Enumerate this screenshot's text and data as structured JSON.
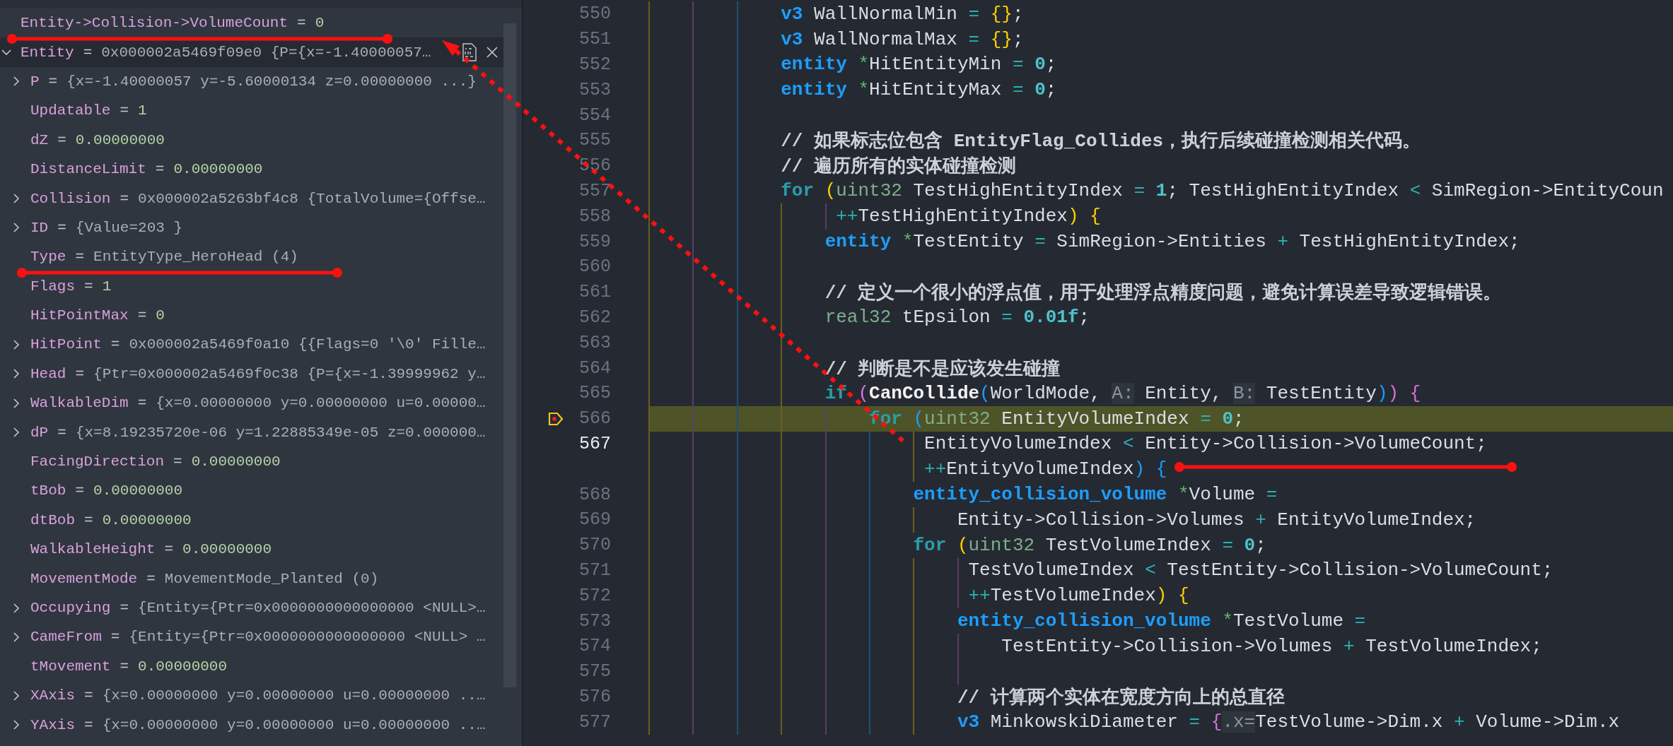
{
  "watch": {
    "items": [
      {
        "kind": "number",
        "selected": false,
        "name": "Entity->Collision->VolumeCount",
        "op": "=",
        "value": "0"
      },
      {
        "kind": "group",
        "expanded": true,
        "selected": true,
        "name": "Entity",
        "op": "=",
        "value": "0x000002a5469f09e0 {P={x=-1.40000057…",
        "children": [
          {
            "kind": "group",
            "expanded": false,
            "selected": false,
            "name": "P",
            "op": "=",
            "value": "{x=-1.40000057 y=-5.60000134 z=0.00000000 ...}"
          },
          {
            "kind": "number",
            "selected": false,
            "name": "Updatable",
            "op": "=",
            "value": "1"
          },
          {
            "kind": "number",
            "selected": false,
            "name": "dZ",
            "op": "=",
            "value": "0.00000000"
          },
          {
            "kind": "number",
            "selected": false,
            "name": "DistanceLimit",
            "op": "=",
            "value": "0.00000000"
          },
          {
            "kind": "group",
            "expanded": false,
            "selected": false,
            "name": "Collision",
            "op": "=",
            "value": "0x000002a5263bf4c8 {TotalVolume={Offse…"
          },
          {
            "kind": "group",
            "expanded": false,
            "selected": false,
            "name": "ID",
            "op": "=",
            "value": "{Value=203 }"
          },
          {
            "kind": "text",
            "selected": false,
            "name": "Type",
            "op": "=",
            "value": "EntityType_HeroHead (4)"
          },
          {
            "kind": "number",
            "selected": false,
            "name": "Flags",
            "op": "=",
            "value": "1"
          },
          {
            "kind": "number",
            "selected": false,
            "name": "HitPointMax",
            "op": "=",
            "value": "0"
          },
          {
            "kind": "group",
            "expanded": false,
            "selected": false,
            "name": "HitPoint",
            "op": "=",
            "value": "0x000002a5469f0a10 {{Flags=0 '\\0' Fille…"
          },
          {
            "kind": "group",
            "expanded": false,
            "selected": false,
            "name": "Head",
            "op": "=",
            "value": "{Ptr=0x000002a5469f0c38 {P={x=-1.39999962 y…"
          },
          {
            "kind": "group",
            "expanded": false,
            "selected": false,
            "name": "WalkableDim",
            "op": "=",
            "value": "{x=0.00000000 y=0.00000000 u=0.00000…"
          },
          {
            "kind": "group",
            "expanded": false,
            "selected": false,
            "name": "dP",
            "op": "=",
            "value": "{x=8.19235720e-06 y=1.22885349e-05 z=0.000000…"
          },
          {
            "kind": "number",
            "selected": false,
            "name": "FacingDirection",
            "op": "=",
            "value": "0.00000000"
          },
          {
            "kind": "number",
            "selected": false,
            "name": "tBob",
            "op": "=",
            "value": "0.00000000"
          },
          {
            "kind": "number",
            "selected": false,
            "name": "dtBob",
            "op": "=",
            "value": "0.00000000"
          },
          {
            "kind": "number",
            "selected": false,
            "name": "WalkableHeight",
            "op": "=",
            "value": "0.00000000"
          },
          {
            "kind": "text",
            "selected": false,
            "name": "MovementMode",
            "op": "=",
            "value": "MovementMode_Planted (0)"
          },
          {
            "kind": "group",
            "expanded": false,
            "selected": false,
            "name": "Occupying",
            "op": "=",
            "value": "{Entity={Ptr=0x0000000000000000 <NULL>…"
          },
          {
            "kind": "group",
            "expanded": false,
            "selected": false,
            "name": "CameFrom",
            "op": "=",
            "value": "{Entity={Ptr=0x0000000000000000 <NULL> …"
          },
          {
            "kind": "number",
            "selected": false,
            "name": "tMovement",
            "op": "=",
            "value": "0.00000000"
          },
          {
            "kind": "group",
            "expanded": false,
            "selected": false,
            "name": "XAxis",
            "op": "=",
            "value": "{x=0.00000000 y=0.00000000 u=0.00000000 ..…"
          },
          {
            "kind": "group",
            "expanded": false,
            "selected": false,
            "name": "YAxis",
            "op": "=",
            "value": "{x=0.00000000 y=0.00000000 u=0.00000000 ..…"
          }
        ]
      }
    ]
  },
  "editor": {
    "lines": [
      {
        "kind": "line",
        "number": "550",
        "tokens": [
          {
            "kind": "type",
            "text": "            v3"
          },
          {
            "kind": "plain",
            "text": " WallNormalMin "
          },
          {
            "kind": "op",
            "text": "="
          },
          {
            "kind": "b1",
            "text": " {}"
          },
          {
            "kind": "punct",
            "text": ";"
          }
        ]
      },
      {
        "kind": "line",
        "number": "551",
        "tokens": [
          {
            "kind": "type",
            "text": "            v3"
          },
          {
            "kind": "plain",
            "text": " WallNormalMax "
          },
          {
            "kind": "op",
            "text": "="
          },
          {
            "kind": "b1",
            "text": " {}"
          },
          {
            "kind": "punct",
            "text": ";"
          }
        ]
      },
      {
        "kind": "line",
        "number": "552",
        "tokens": [
          {
            "kind": "type",
            "text": "            entity"
          },
          {
            "kind": "ptr",
            "text": " *"
          },
          {
            "kind": "plain",
            "text": "HitEntityMin "
          },
          {
            "kind": "op",
            "text": "="
          },
          {
            "kind": "num",
            "text": " 0"
          },
          {
            "kind": "punct",
            "text": ";"
          }
        ]
      },
      {
        "kind": "line",
        "number": "553",
        "tokens": [
          {
            "kind": "type",
            "text": "            entity"
          },
          {
            "kind": "ptr",
            "text": " *"
          },
          {
            "kind": "plain",
            "text": "HitEntityMax "
          },
          {
            "kind": "op",
            "text": "="
          },
          {
            "kind": "num",
            "text": " 0"
          },
          {
            "kind": "punct",
            "text": ";"
          }
        ]
      },
      {
        "kind": "line",
        "number": "554"
      },
      {
        "kind": "line",
        "number": "555",
        "tokens": [
          {
            "kind": "comment",
            "text": "            // 如果标志位包含 EntityFlag_Collides，执行后续碰撞检测相关代码。"
          }
        ]
      },
      {
        "kind": "line",
        "number": "556",
        "tokens": [
          {
            "kind": "comment",
            "text": "            // 遍历所有的实体碰撞检测"
          }
        ]
      },
      {
        "kind": "line",
        "number": "557",
        "tokens": [
          {
            "kind": "kw",
            "text": "            for"
          },
          {
            "kind": "b1",
            "text": " ("
          },
          {
            "kind": "prim",
            "text": "uint32"
          },
          {
            "kind": "plain",
            "text": " TestHighEntityIndex "
          },
          {
            "kind": "op",
            "text": "="
          },
          {
            "kind": "num",
            "text": " 1"
          },
          {
            "kind": "punct",
            "text": ";"
          },
          {
            "kind": "plain",
            "text": " TestHighEntityIndex "
          },
          {
            "kind": "op",
            "text": "<"
          },
          {
            "kind": "plain",
            "text": " SimRegion->EntityCoun"
          }
        ]
      },
      {
        "kind": "line",
        "number": "558",
        "tokens": [
          {
            "kind": "op",
            "text": "                 ++"
          },
          {
            "kind": "plain",
            "text": "TestHighEntityIndex"
          },
          {
            "kind": "b1",
            "text": ")"
          },
          {
            "kind": "b1",
            "text": " {"
          }
        ]
      },
      {
        "kind": "line",
        "number": "559",
        "tokens": [
          {
            "kind": "type",
            "text": "                entity"
          },
          {
            "kind": "ptr",
            "text": " *"
          },
          {
            "kind": "plain",
            "text": "TestEntity "
          },
          {
            "kind": "op",
            "text": "="
          },
          {
            "kind": "plain",
            "text": " SimRegion->Entities "
          },
          {
            "kind": "op",
            "text": "+"
          },
          {
            "kind": "plain",
            "text": " TestHighEntityIndex;"
          }
        ]
      },
      {
        "kind": "line",
        "number": "560"
      },
      {
        "kind": "line",
        "number": "561",
        "tokens": [
          {
            "kind": "comment",
            "text": "                // 定义一个很小的浮点值，用于处理浮点精度问题，避免计算误差导致逻辑错误。"
          }
        ]
      },
      {
        "kind": "line",
        "number": "562",
        "tokens": [
          {
            "kind": "prim",
            "text": "                real32"
          },
          {
            "kind": "plain",
            "text": " tEpsilon "
          },
          {
            "kind": "op",
            "text": "="
          },
          {
            "kind": "num",
            "text": " 0.01f"
          },
          {
            "kind": "punct",
            "text": ";"
          }
        ]
      },
      {
        "kind": "line",
        "number": "563"
      },
      {
        "kind": "line",
        "number": "564",
        "tokens": [
          {
            "kind": "comment",
            "text": "                // 判断是不是应该发生碰撞"
          }
        ]
      },
      {
        "kind": "line",
        "number": "565",
        "tokens": [
          {
            "kind": "kw",
            "text": "                if"
          },
          {
            "kind": "b2",
            "text": " ("
          },
          {
            "kind": "func",
            "text": "CanCollide"
          },
          {
            "kind": "b3",
            "text": "("
          },
          {
            "kind": "plain",
            "text": "WorldMode, "
          },
          {
            "kind": "hint",
            "text": "A:"
          },
          {
            "kind": "plain",
            "text": " Entity, "
          },
          {
            "kind": "hint",
            "text": "B:"
          },
          {
            "kind": "plain",
            "text": " TestEntity"
          },
          {
            "kind": "b3",
            "text": ")"
          },
          {
            "kind": "b2",
            "text": ")"
          },
          {
            "kind": "b2",
            "text": " {"
          }
        ]
      },
      {
        "kind": "paused",
        "number": "566",
        "tokens": [
          {
            "kind": "kw",
            "text": "                    for"
          },
          {
            "kind": "b3",
            "text": " ("
          },
          {
            "kind": "prim",
            "text": "uint32"
          },
          {
            "kind": "plain",
            "text": " EntityVolumeIndex "
          },
          {
            "kind": "op",
            "text": "="
          },
          {
            "kind": "num",
            "text": " 0"
          },
          {
            "kind": "punct",
            "text": ";"
          }
        ]
      },
      {
        "kind": "cursor",
        "number": "567",
        "tokens": [
          {
            "kind": "plain",
            "text": "                         EntityVolumeIndex "
          },
          {
            "kind": "op",
            "text": "<"
          },
          {
            "kind": "plain",
            "text": " Entity->Collision->VolumeCount;"
          }
        ]
      },
      {
        "kind": "wrap",
        "tokens": [
          {
            "kind": "op",
            "text": "                         ++"
          },
          {
            "kind": "plain",
            "text": "EntityVolumeIndex"
          },
          {
            "kind": "b3",
            "text": ")"
          },
          {
            "kind": "b3",
            "text": " {"
          }
        ]
      },
      {
        "kind": "line",
        "number": "568",
        "tokens": [
          {
            "kind": "type",
            "text": "                        entity_collision_volume"
          },
          {
            "kind": "ptr",
            "text": " *"
          },
          {
            "kind": "plain",
            "text": "Volume "
          },
          {
            "kind": "op",
            "text": "="
          }
        ]
      },
      {
        "kind": "line",
        "number": "569",
        "tokens": [
          {
            "kind": "plain",
            "text": "                            Entity->Collision->Volumes "
          },
          {
            "kind": "op",
            "text": "+"
          },
          {
            "kind": "plain",
            "text": " EntityVolumeIndex;"
          }
        ]
      },
      {
        "kind": "line",
        "number": "570",
        "tokens": [
          {
            "kind": "kw",
            "text": "                        for"
          },
          {
            "kind": "b1",
            "text": " ("
          },
          {
            "kind": "prim",
            "text": "uint32"
          },
          {
            "kind": "plain",
            "text": " TestVolumeIndex "
          },
          {
            "kind": "op",
            "text": "="
          },
          {
            "kind": "num",
            "text": " 0"
          },
          {
            "kind": "punct",
            "text": ";"
          }
        ]
      },
      {
        "kind": "line",
        "number": "571",
        "tokens": [
          {
            "kind": "plain",
            "text": "                             TestVolumeIndex "
          },
          {
            "kind": "op",
            "text": "<"
          },
          {
            "kind": "plain",
            "text": " TestEntity->Collision->VolumeCount;"
          }
        ]
      },
      {
        "kind": "line",
        "number": "572",
        "tokens": [
          {
            "kind": "op",
            "text": "                             ++"
          },
          {
            "kind": "plain",
            "text": "TestVolumeIndex"
          },
          {
            "kind": "b1",
            "text": ")"
          },
          {
            "kind": "b1",
            "text": " {"
          }
        ]
      },
      {
        "kind": "line",
        "number": "573",
        "tokens": [
          {
            "kind": "type",
            "text": "                            entity_collision_volume"
          },
          {
            "kind": "ptr",
            "text": " *"
          },
          {
            "kind": "plain",
            "text": "TestVolume "
          },
          {
            "kind": "op",
            "text": "="
          }
        ]
      },
      {
        "kind": "line",
        "number": "574",
        "tokens": [
          {
            "kind": "plain",
            "text": "                                TestEntity->Collision->Volumes "
          },
          {
            "kind": "op",
            "text": "+"
          },
          {
            "kind": "plain",
            "text": " TestVolumeIndex;"
          }
        ]
      },
      {
        "kind": "line",
        "number": "575"
      },
      {
        "kind": "line",
        "number": "576",
        "tokens": [
          {
            "kind": "comment",
            "text": "                            // 计算两个实体在宽度方向上的总直径"
          }
        ]
      },
      {
        "kind": "line",
        "number": "577",
        "tokens": [
          {
            "kind": "type",
            "text": "                            v3"
          },
          {
            "kind": "plain",
            "text": " MinkowskiDiameter "
          },
          {
            "kind": "op",
            "text": "="
          },
          {
            "kind": "b2",
            "text": " {"
          },
          {
            "kind": "hint",
            "text": ".x="
          },
          {
            "kind": "plain",
            "text": "TestVolume->Dim.x "
          },
          {
            "kind": "op",
            "text": "+"
          },
          {
            "kind": "plain",
            "text": " Volume->Dim.x"
          }
        ]
      }
    ]
  },
  "annotations": [
    {
      "kind": "underline"
    },
    {
      "kind": "underline"
    },
    {
      "kind": "arrow"
    },
    {
      "kind": "underline"
    }
  ]
}
